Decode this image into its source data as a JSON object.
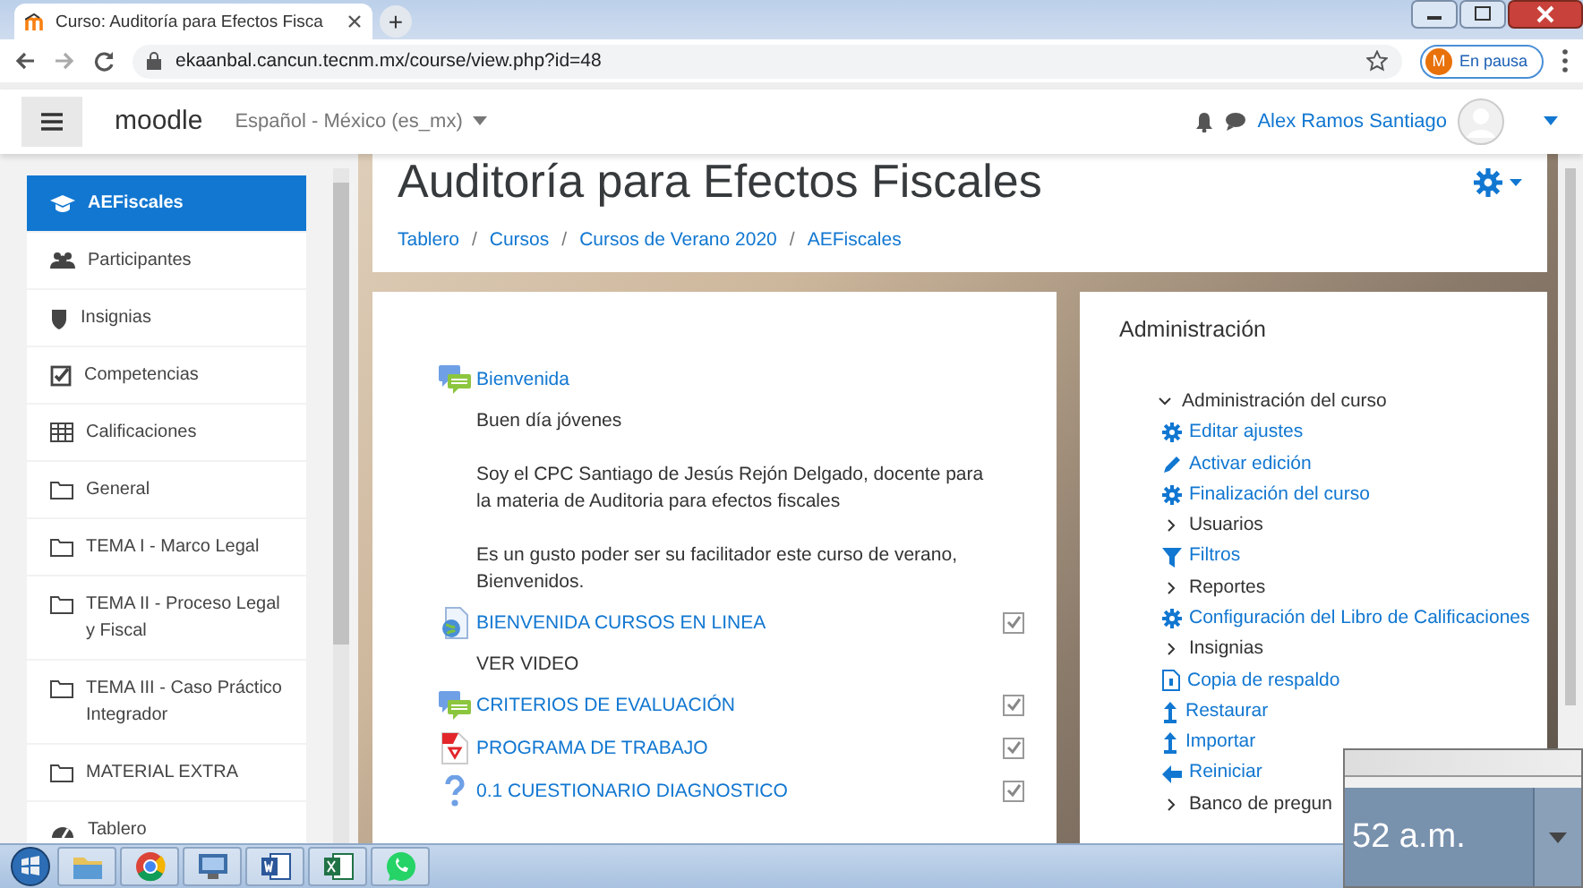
{
  "browser": {
    "tab_title": "Curso: Auditoría para Efectos Fisca",
    "new_tab": "+",
    "url": "ekaanbal.cancun.tecnm.mx/course/view.php?id=48",
    "profile_initial": "M",
    "profile_status": "En pausa"
  },
  "navbar": {
    "brand": "moodle",
    "language": "Español - México (es_mx)",
    "user": "Alex Ramos Santiago"
  },
  "course_index": [
    {
      "label": "AEFiscales",
      "selected": true
    },
    {
      "label": "Participantes",
      "selected": false
    },
    {
      "label": "Insignias",
      "selected": false
    },
    {
      "label": "Competencias",
      "selected": false
    },
    {
      "label": "Calificaciones",
      "selected": false
    },
    {
      "label": "General",
      "selected": false
    },
    {
      "label": "TEMA I - Marco Legal",
      "selected": false
    },
    {
      "label": "TEMA II - Proceso Legal y Fiscal",
      "selected": false
    },
    {
      "label": "TEMA III - Caso Práctico Integrador",
      "selected": false
    },
    {
      "label": "MATERIAL EXTRA",
      "selected": false
    },
    {
      "label": "Tablero",
      "selected": false
    }
  ],
  "header": {
    "title": "Auditoría para Efectos Fiscales",
    "breadcrumbs": [
      {
        "label": "Tablero"
      },
      {
        "separator": "/",
        "label": "Cursos"
      },
      {
        "separator": "/",
        "label": "Cursos de Verano 2020"
      },
      {
        "separator": "/",
        "label": "AEFiscales"
      }
    ]
  },
  "activities": [
    {
      "kind": "forum",
      "label": "Bienvenida"
    },
    {
      "kind": "text",
      "text": "Buen día jóvenes"
    },
    {
      "kind": "text",
      "text": "Soy el CPC Santiago de Jesús Rejón Delgado, docente para la materia de Auditoria para efectos fiscales"
    },
    {
      "kind": "text",
      "text": "Es un gusto poder ser su facilitador este curso de verano, Bienvenidos."
    },
    {
      "kind": "url",
      "label": "BIENVENIDA CURSOS EN LINEA",
      "checked": true
    },
    {
      "kind": "text",
      "text": "VER VIDEO"
    },
    {
      "kind": "forum",
      "label": "CRITERIOS DE EVALUACIÓN",
      "checked": true
    },
    {
      "kind": "resource",
      "label": "PROGRAMA DE TRABAJO",
      "checked": true
    },
    {
      "kind": "quiz",
      "label": "0.1 CUESTIONARIO DIAGNOSTICO",
      "checked": true
    }
  ],
  "administration": {
    "title": "Administración",
    "tree": [
      {
        "kind": "node",
        "label": "Administración del curso",
        "expanded": true,
        "children": [
          {
            "kind": "link",
            "label": "Editar ajustes"
          },
          {
            "kind": "link",
            "label": "Activar edición"
          },
          {
            "kind": "link",
            "label": "Finalización del curso"
          },
          {
            "kind": "node",
            "label": "Usuarios",
            "expanded": false
          },
          {
            "kind": "link",
            "label": "Filtros"
          },
          {
            "kind": "node",
            "label": "Reportes",
            "expanded": false
          },
          {
            "kind": "link",
            "label": "Configuración del Libro de Calificaciones"
          },
          {
            "kind": "node",
            "label": "Insignias",
            "expanded": false
          },
          {
            "kind": "link",
            "label": "Copia de respaldo"
          },
          {
            "kind": "link",
            "label": "Restaurar"
          },
          {
            "kind": "link",
            "label": "Importar"
          },
          {
            "kind": "link",
            "label": "Reiniciar"
          },
          {
            "kind": "node",
            "label": "Banco de pregun",
            "expanded": false
          }
        ]
      }
    ]
  },
  "clock_popup": {
    "time": "52 a.m."
  }
}
